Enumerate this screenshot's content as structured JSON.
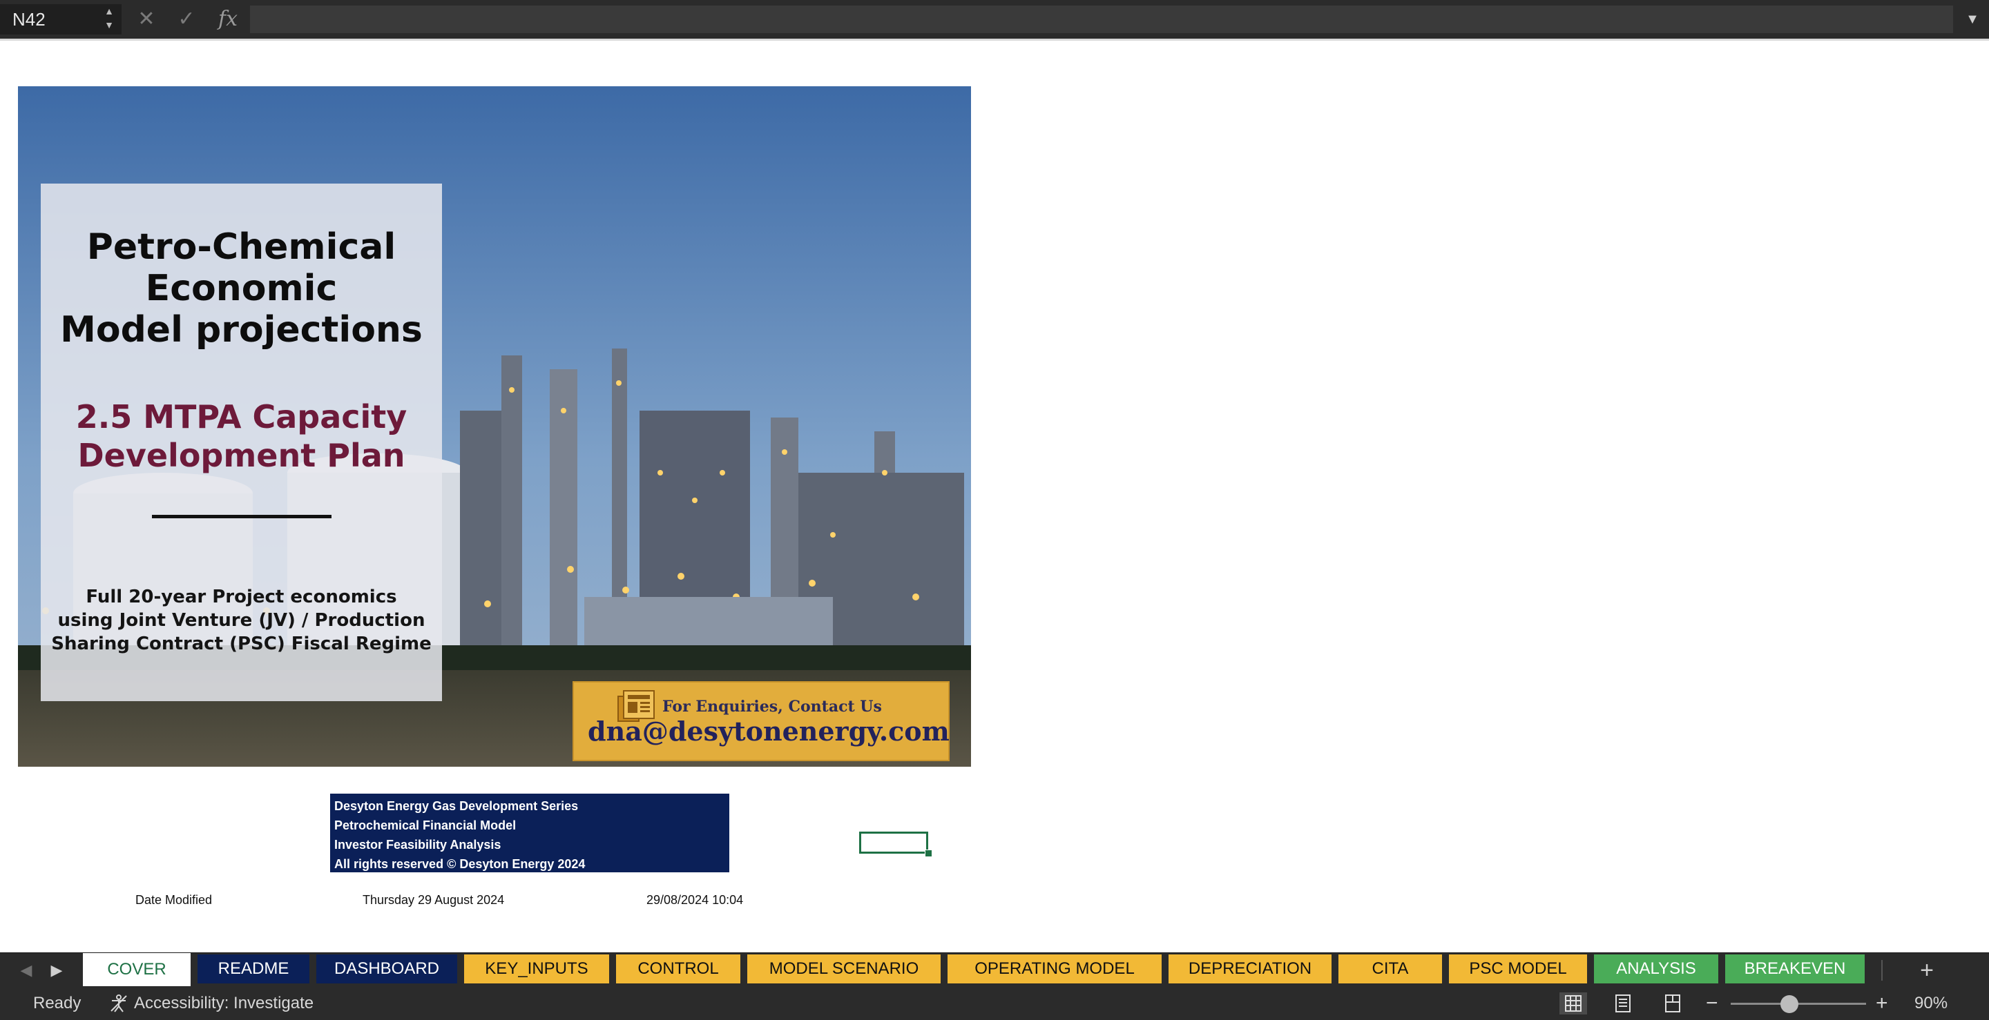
{
  "formula_bar": {
    "name_box": "N42",
    "fx_label": "fx",
    "formula": ""
  },
  "cover": {
    "title": "Petro-Chemical\nEconomic\nModel  projections",
    "subtitle": "2.5 MTPA Capacity\nDevelopment Plan",
    "description": "Full 20-year Project economics\nusing Joint Venture (JV) / Production\nSharing Contract (PSC) Fiscal Regime",
    "contact_caption": "For Enquiries, Contact Us",
    "contact_email": "dna@desytonenergy.com"
  },
  "series_box": {
    "lines": [
      "Desyton Energy Gas Development Series",
      "Petrochemical Financial Model",
      "Investor Feasibility Analysis",
      "All rights reserved © Desyton Energy 2024"
    ]
  },
  "cells": {
    "date_modified_label": "Date Modified",
    "date_long": "Thursday 29 August 2024",
    "date_time": "29/08/2024 10:04"
  },
  "sheet_tabs": [
    {
      "label": "COVER",
      "style": "active"
    },
    {
      "label": "README",
      "style": "navy"
    },
    {
      "label": "DASHBOARD",
      "style": "navy"
    },
    {
      "label": "KEY_INPUTS",
      "style": "gold"
    },
    {
      "label": "CONTROL",
      "style": "gold"
    },
    {
      "label": "MODEL SCENARIO",
      "style": "gold"
    },
    {
      "label": "OPERATING MODEL",
      "style": "gold"
    },
    {
      "label": "DEPRECIATION",
      "style": "gold"
    },
    {
      "label": "CITA",
      "style": "gold"
    },
    {
      "label": "PSC MODEL",
      "style": "gold"
    },
    {
      "label": "ANALYSIS",
      "style": "green"
    },
    {
      "label": "BREAKEVEN",
      "style": "green"
    }
  ],
  "status_bar": {
    "ready": "Ready",
    "accessibility": "Accessibility: Investigate",
    "zoom": "90%"
  },
  "icons": {
    "close": "✕",
    "check": "✓",
    "expand": "▼",
    "prev": "◀",
    "next": "▶",
    "add": "+",
    "minus": "−",
    "plus": "+"
  },
  "colors": {
    "navy": "#0b2058",
    "gold": "#f2b936",
    "green": "#4aac58",
    "accent": "#1e7145",
    "subtitle": "#6d1a3a"
  }
}
